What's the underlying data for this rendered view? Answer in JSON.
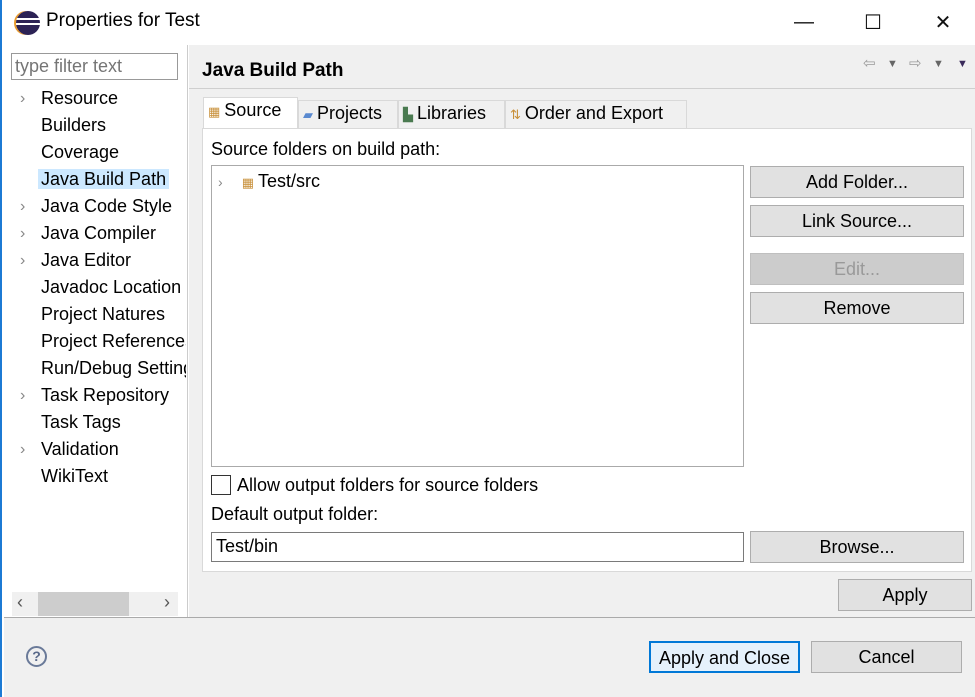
{
  "window": {
    "title": "Properties for Test",
    "minimize": "—",
    "maximize": "☐",
    "close": "✕"
  },
  "filter": {
    "placeholder": "type filter text"
  },
  "tree": [
    {
      "label": "Resource",
      "expandable": true
    },
    {
      "label": "Builders",
      "expandable": false
    },
    {
      "label": "Coverage",
      "expandable": false
    },
    {
      "label": "Java Build Path",
      "expandable": false,
      "selected": true
    },
    {
      "label": "Java Code Style",
      "expandable": true
    },
    {
      "label": "Java Compiler",
      "expandable": true
    },
    {
      "label": "Java Editor",
      "expandable": true
    },
    {
      "label": "Javadoc Location",
      "expandable": false
    },
    {
      "label": "Project Natures",
      "expandable": false
    },
    {
      "label": "Project References",
      "expandable": false
    },
    {
      "label": "Run/Debug Settings",
      "expandable": false
    },
    {
      "label": "Task Repository",
      "expandable": true
    },
    {
      "label": "Task Tags",
      "expandable": false
    },
    {
      "label": "Validation",
      "expandable": true
    },
    {
      "label": "WikiText",
      "expandable": false
    }
  ],
  "page": {
    "title": "Java Build Path",
    "tabs": [
      {
        "label": "Source",
        "icon": "source-folder-icon"
      },
      {
        "label": "Projects",
        "icon": "folder-icon"
      },
      {
        "label": "Libraries",
        "icon": "library-icon"
      },
      {
        "label": "Order and Export",
        "icon": "order-icon"
      }
    ],
    "source_label": "Source folders on build path:",
    "folders": [
      "Test/src"
    ],
    "buttons": {
      "add_folder": "Add Folder...",
      "link_source": "Link Source...",
      "edit": "Edit...",
      "remove": "Remove",
      "browse": "Browse...",
      "apply": "Apply"
    },
    "allow_output": "Allow output folders for source folders",
    "allow_output_checked": false,
    "default_output_label": "Default output folder:",
    "default_output_value": "Test/bin"
  },
  "footer": {
    "apply_close": "Apply and Close",
    "cancel": "Cancel",
    "help": "?"
  },
  "colors": {
    "selection": "#cce8ff",
    "focus_border": "#0078d7"
  }
}
